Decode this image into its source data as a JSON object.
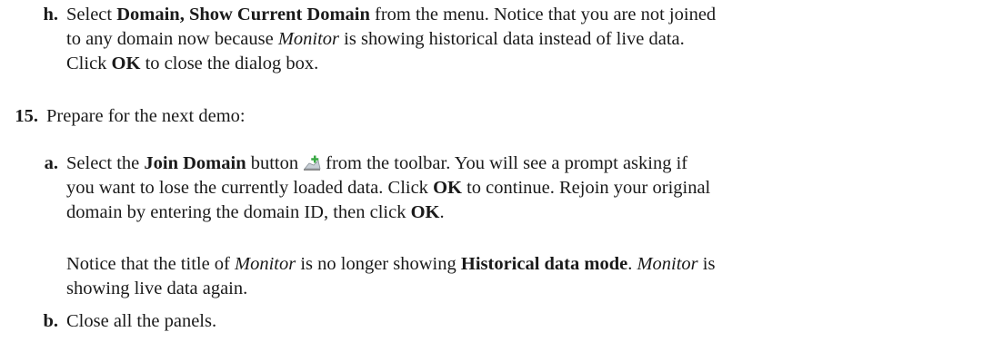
{
  "step_h": {
    "label": "h.",
    "lines": [
      [
        {
          "t": "Select ",
          "s": ""
        },
        {
          "t": "Domain, Show Current Domain",
          "s": "b"
        },
        {
          "t": " from the menu. Notice that you are not joined",
          "s": ""
        }
      ],
      [
        {
          "t": "to any domain now because ",
          "s": ""
        },
        {
          "t": "Monitor",
          "s": "i"
        },
        {
          "t": " is showing historical data instead of live data.",
          "s": ""
        }
      ],
      [
        {
          "t": "Click ",
          "s": ""
        },
        {
          "t": "OK",
          "s": "b"
        },
        {
          "t": " to close the dialog box.",
          "s": ""
        }
      ]
    ]
  },
  "step_15": {
    "label": "15.",
    "lines": [
      [
        {
          "t": "Prepare for the next demo:",
          "s": ""
        }
      ]
    ]
  },
  "step_a": {
    "label": "a.",
    "lines": [
      [
        {
          "t": "Select the ",
          "s": ""
        },
        {
          "t": "Join Domain",
          "s": "b"
        },
        {
          "t": " button",
          "s": ""
        },
        {
          "icon": "join-domain-icon"
        },
        {
          "t": "from the toolbar. You will see a prompt asking if",
          "s": ""
        }
      ],
      [
        {
          "t": "you want to lose the currently loaded data. Click ",
          "s": ""
        },
        {
          "t": "OK",
          "s": "b"
        },
        {
          "t": " to continue. Rejoin your original",
          "s": ""
        }
      ],
      [
        {
          "t": "domain by entering the domain ID, then click ",
          "s": ""
        },
        {
          "t": "OK",
          "s": "b"
        },
        {
          "t": ".",
          "s": ""
        }
      ]
    ]
  },
  "note": {
    "lines": [
      [
        {
          "t": "Notice that the title of ",
          "s": ""
        },
        {
          "t": "Monitor",
          "s": "i"
        },
        {
          "t": " is no longer showing ",
          "s": ""
        },
        {
          "t": "Historical data mode",
          "s": "b"
        },
        {
          "t": ". ",
          "s": ""
        },
        {
          "t": "Monitor",
          "s": "i"
        },
        {
          "t": " is",
          "s": ""
        }
      ],
      [
        {
          "t": "showing live data again.",
          "s": ""
        }
      ]
    ]
  },
  "step_b": {
    "label": "b.",
    "lines": [
      [
        {
          "t": "Close all the panels.",
          "s": ""
        }
      ]
    ]
  }
}
